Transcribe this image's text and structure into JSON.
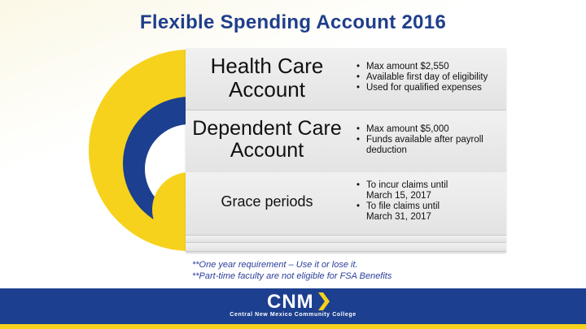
{
  "slide": {
    "title": "Flexible Spending Account 2016"
  },
  "rows": [
    {
      "label": "Health Care Account",
      "bullets": [
        "Max amount $2,550",
        "Available first day of eligibility",
        "Used for qualified expenses"
      ]
    },
    {
      "label": "Dependent Care Account",
      "bullets": [
        "Max amount $5,000",
        "Funds available after payroll deduction"
      ]
    },
    {
      "label": "Grace periods",
      "bullets": [
        "To incur claims until March 15, 2017",
        "To file claims until March 31, 2017"
      ]
    }
  ],
  "notes": [
    "**One year requirement – Use it or lose it.",
    "**Part-time faculty are not eligible for FSA Benefits"
  ],
  "footer": {
    "logo_text": "CNM",
    "tagline": "Central New Mexico Community College"
  },
  "colors": {
    "title": "#1f3e8c",
    "arc_outer": "#f6d21c",
    "arc_middle": "#1c3f8f",
    "arc_inner": "#f6d21c",
    "footer": "#1c3f8f",
    "footer_stripe": "#f6d21c"
  }
}
